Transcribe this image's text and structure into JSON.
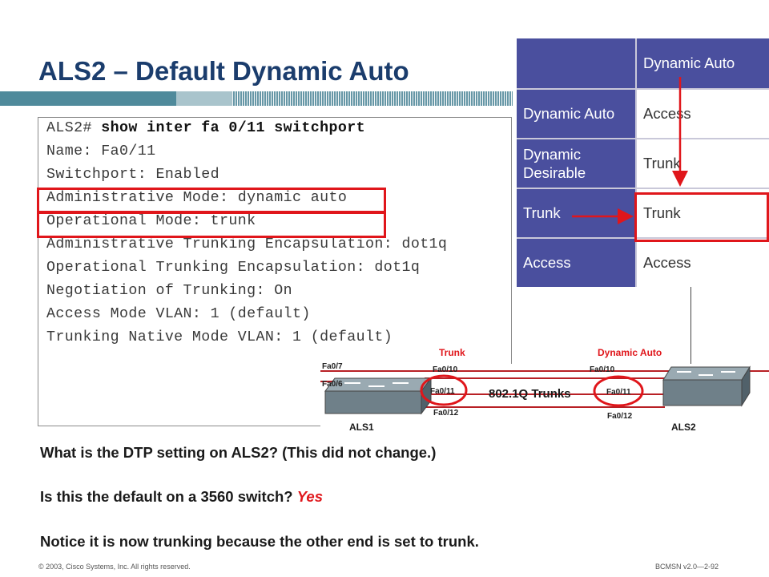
{
  "title": "ALS2 – Default Dynamic Auto",
  "cli": {
    "prompt": "ALS2#",
    "command": "show inter fa 0/11 switchport",
    "lines": [
      "Name: Fa0/11",
      "Switchport: Enabled",
      "Administrative Mode: dynamic auto",
      "Operational Mode: trunk",
      "Administrative Trunking Encapsulation: dot1q",
      "Operational Trunking Encapsulation: dot1q",
      "Negotiation of Trunking: On",
      "Access Mode VLAN: 1 (default)",
      "Trunking Native Mode VLAN: 1 (default)"
    ]
  },
  "dtp_table": {
    "column_header": "Dynamic Auto",
    "rows": [
      {
        "mode": "Dynamic Auto",
        "result": "Access"
      },
      {
        "mode": "Dynamic Desirable",
        "result": "Trunk"
      },
      {
        "mode": "Trunk",
        "result": "Trunk"
      },
      {
        "mode": "Access",
        "result": "Access"
      }
    ]
  },
  "topology": {
    "label_left": "Trunk",
    "label_right": "Dynamic Auto",
    "link_label": "802.1Q Trunks",
    "switch_left": "ALS1",
    "switch_right": "ALS2",
    "ports_left": [
      "Fa0/10",
      "Fa0/11",
      "Fa0/12",
      "Fa0/6"
    ],
    "ports_right": [
      "Fa0/10",
      "Fa0/11",
      "Fa0/12"
    ],
    "partial_label_left": "Fa0/7"
  },
  "questions": {
    "q1": "What is the DTP setting on ALS2? (This did not change.)",
    "q2": "Is this the default on a 3560 switch?",
    "q2_answer": "Yes",
    "q3": "Notice it is now trunking because the other end is set to trunk."
  },
  "footer": {
    "copyright": "© 2003, Cisco Systems, Inc. All rights reserved.",
    "course": "BCMSN v2.0—2-92"
  },
  "colors": {
    "highlight_red": "#e0161b",
    "table_left_header": "#4a4f9e",
    "title_blue": "#1b3d6d"
  }
}
